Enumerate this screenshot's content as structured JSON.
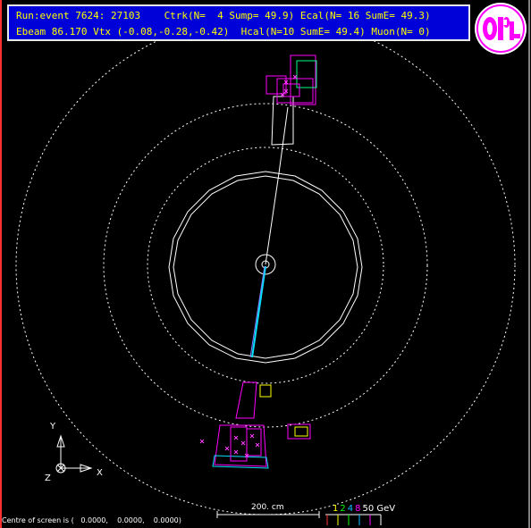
{
  "header": {
    "line1": "Run:event 7624: 27103    Ctrk(N=  4 Sump= 49.9) Ecal(N= 16 SumE= 49.3)",
    "line2": "Ebeam 86.170 Vtx (-0.08,-0.28,-0.42)  Hcal(N=10 SumE= 49.4) Muon(N= 0)"
  },
  "logo": {
    "text": "OPAL",
    "colors": {
      "ring": "#ff00ff",
      "fill": "#ffffff"
    }
  },
  "axes": {
    "y_label": "Y",
    "x_label": "X",
    "z_label": "Z"
  },
  "footer": {
    "centre_text": "Centre of screen is (   0.0000,    0.0000,    0.0000)",
    "scale_label": "200. cm"
  },
  "energy_legend": {
    "items": [
      {
        "text": "1",
        "color": "#ffff00"
      },
      {
        "text": "2",
        "color": "#00ff00"
      },
      {
        "text": "4",
        "color": "#00c0ff"
      },
      {
        "text": "8",
        "color": "#ff00ff"
      },
      {
        "text": "50 GeV",
        "color": "#ffffff"
      }
    ]
  },
  "colors": {
    "background": "#000000",
    "detector_lines": "#ffffff",
    "track_cyan": "#00e0ff",
    "ecal_magenta": "#ff00ff",
    "hcal_yellow": "#ffff00",
    "header_bg": "#0000d8",
    "header_text": "#ffff00"
  }
}
